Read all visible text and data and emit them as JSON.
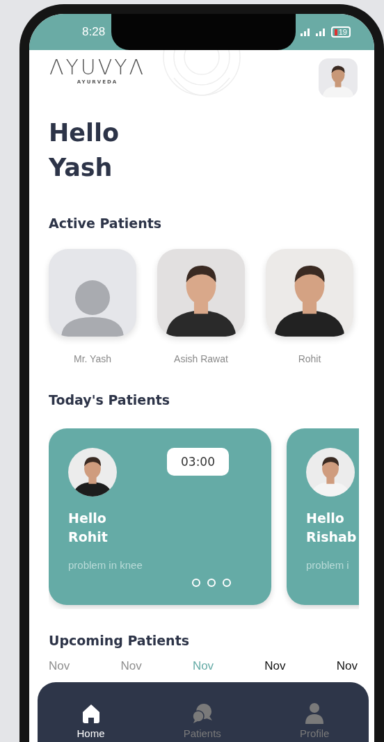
{
  "status_bar": {
    "time": "8:28",
    "battery": "19"
  },
  "header": {
    "logo": "ΛYUVYΛ",
    "logo_tagline": "AYURVEDA"
  },
  "greeting": [
    "Hello",
    "Yash"
  ],
  "active_patients": {
    "title": "Active Patients",
    "items": [
      {
        "name": "Mr. Yash",
        "kind": "placeholder"
      },
      {
        "name": "Asish Rawat",
        "kind": "picture"
      },
      {
        "name": "Rohit",
        "kind": "picture"
      }
    ]
  },
  "todays_patients": {
    "title": "Today's Patients",
    "cards": [
      {
        "greeting": [
          "Hello",
          "Rohit"
        ],
        "problem": "problem in knee",
        "time": "03:00",
        "pager_dots": [
          {
            "selected": false
          },
          {
            "selected": false
          },
          {
            "selected": false
          }
        ]
      },
      {
        "greeting": [
          "Hello",
          "Rishab"
        ],
        "problem": "problem i"
      }
    ]
  },
  "upcoming_patients": {
    "title": "Upcoming Patients",
    "days": [
      {
        "month": "Nov",
        "past": true,
        "selected": false
      },
      {
        "month": "Nov",
        "past": true,
        "selected": false
      },
      {
        "month": "Nov",
        "past": false,
        "selected": true
      },
      {
        "month": "Nov",
        "past": false,
        "selected": false
      },
      {
        "month": "Nov",
        "past": false,
        "selected": false
      }
    ]
  },
  "nav": [
    {
      "label": "Home",
      "kind": "home",
      "selected": true
    },
    {
      "label": "Patients",
      "kind": "chat",
      "selected": false
    },
    {
      "label": "Profile",
      "kind": "person",
      "selected": false
    }
  ]
}
